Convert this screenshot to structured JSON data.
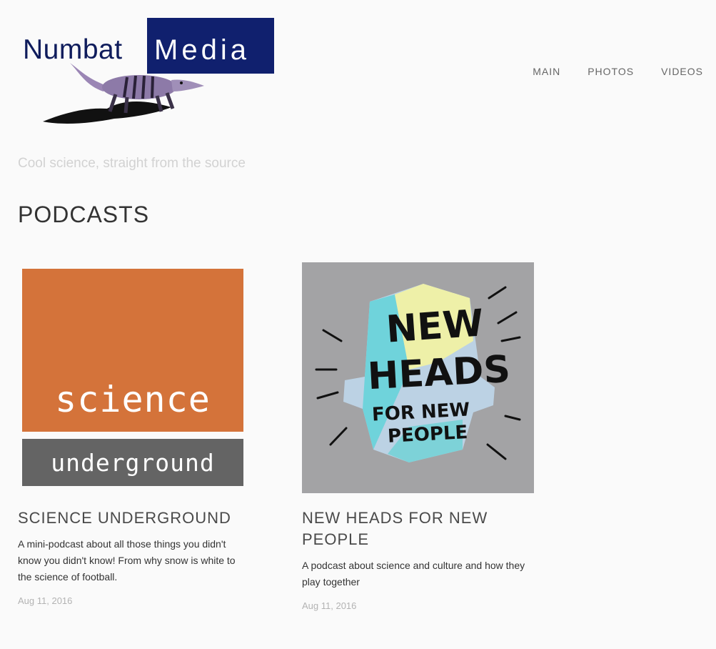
{
  "logo": {
    "word_left": "Numbat",
    "word_right": "Media"
  },
  "nav": {
    "items": [
      {
        "label": "MAIN"
      },
      {
        "label": "PHOTOS"
      },
      {
        "label": "VIDEOS"
      }
    ]
  },
  "tagline": "Cool science, straight from the source",
  "page_title": "PODCASTS",
  "podcasts": [
    {
      "thumb_top": "science",
      "thumb_bottom": "underground",
      "title": "SCIENCE UNDERGROUND",
      "description": "A mini-podcast about all those things you didn't know you didn't know! From why snow is white to the science of football.",
      "date": "Aug 11, 2016"
    },
    {
      "thumb_line1": "NEW",
      "thumb_line2": "HEADS",
      "thumb_line3": "FOR NEW",
      "thumb_line4": "PEOPLE",
      "title": "NEW HEADS FOR NEW PEOPLE",
      "description": "A podcast about science and culture and how they play together",
      "date": "Aug 11, 2016"
    }
  ],
  "colors": {
    "logo_blue": "#10206e",
    "science_orange": "#d4733a",
    "underground_gray": "#646464",
    "newheads_bg": "#a3a3a5"
  }
}
